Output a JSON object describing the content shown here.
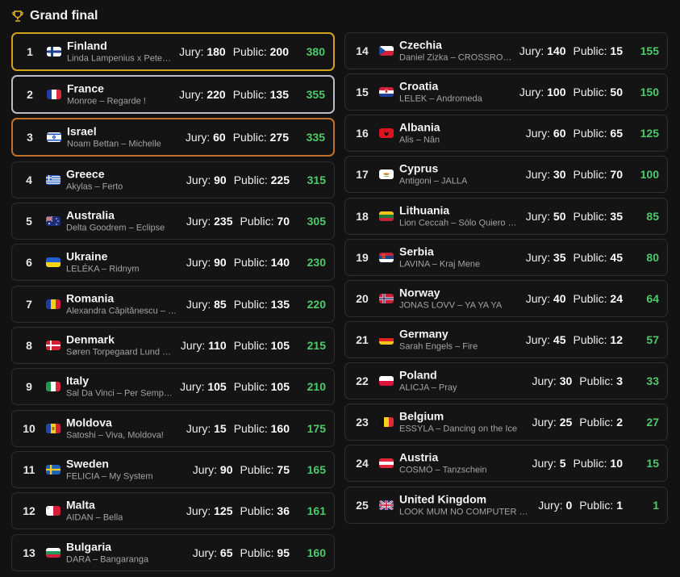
{
  "header": {
    "title": "Grand final",
    "icon": "trophy-icon"
  },
  "labels": {
    "jury": "Jury:",
    "public": "Public:"
  },
  "colors": {
    "gold": "#d4a21a",
    "silver": "#b9bec6",
    "bronze": "#c0702a",
    "total": "#4ccb6a"
  },
  "entries": [
    {
      "rank": "1",
      "country": "Finland",
      "artist": "Linda Lampenius x Pete…",
      "jury": "180",
      "public": "200",
      "total": "380",
      "flag": "finland-flag-icon"
    },
    {
      "rank": "2",
      "country": "France",
      "artist": "Monroe – Regarde !",
      "jury": "220",
      "public": "135",
      "total": "355",
      "flag": "france-flag-icon"
    },
    {
      "rank": "3",
      "country": "Israel",
      "artist": "Noam Bettan – Michelle",
      "jury": "60",
      "public": "275",
      "total": "335",
      "flag": "israel-flag-icon"
    },
    {
      "rank": "4",
      "country": "Greece",
      "artist": "Akylas – Ferto",
      "jury": "90",
      "public": "225",
      "total": "315",
      "flag": "greece-flag-icon"
    },
    {
      "rank": "5",
      "country": "Australia",
      "artist": "Delta Goodrem – Eclipse",
      "jury": "235",
      "public": "70",
      "total": "305",
      "flag": "australia-flag-icon"
    },
    {
      "rank": "6",
      "country": "Ukraine",
      "artist": "LELÉKA – Ridnym",
      "jury": "90",
      "public": "140",
      "total": "230",
      "flag": "ukraine-flag-icon"
    },
    {
      "rank": "7",
      "country": "Romania",
      "artist": "Alexandra Căpitănescu – …",
      "jury": "85",
      "public": "135",
      "total": "220",
      "flag": "romania-flag-icon"
    },
    {
      "rank": "8",
      "country": "Denmark",
      "artist": "Søren Torpegaard Lund …",
      "jury": "110",
      "public": "105",
      "total": "215",
      "flag": "denmark-flag-icon"
    },
    {
      "rank": "9",
      "country": "Italy",
      "artist": "Sal Da Vinci – Per Semp…",
      "jury": "105",
      "public": "105",
      "total": "210",
      "flag": "italy-flag-icon"
    },
    {
      "rank": "10",
      "country": "Moldova",
      "artist": "Satoshi – Viva, Moldova!",
      "jury": "15",
      "public": "160",
      "total": "175",
      "flag": "moldova-flag-icon"
    },
    {
      "rank": "11",
      "country": "Sweden",
      "artist": "FELICIA – My System",
      "jury": "90",
      "public": "75",
      "total": "165",
      "flag": "sweden-flag-icon"
    },
    {
      "rank": "12",
      "country": "Malta",
      "artist": "AIDAN – Bella",
      "jury": "125",
      "public": "36",
      "total": "161",
      "flag": "malta-flag-icon"
    },
    {
      "rank": "13",
      "country": "Bulgaria",
      "artist": "DARA – Bangaranga",
      "jury": "65",
      "public": "95",
      "total": "160",
      "flag": "bulgaria-flag-icon"
    },
    {
      "rank": "14",
      "country": "Czechia",
      "artist": "Daniel Zizka – CROSSRO…",
      "jury": "140",
      "public": "15",
      "total": "155",
      "flag": "czechia-flag-icon"
    },
    {
      "rank": "15",
      "country": "Croatia",
      "artist": "LELEK – Andromeda",
      "jury": "100",
      "public": "50",
      "total": "150",
      "flag": "croatia-flag-icon"
    },
    {
      "rank": "16",
      "country": "Albania",
      "artist": "Alis – Nân",
      "jury": "60",
      "public": "65",
      "total": "125",
      "flag": "albania-flag-icon"
    },
    {
      "rank": "17",
      "country": "Cyprus",
      "artist": "Antigoni – JALLA",
      "jury": "30",
      "public": "70",
      "total": "100",
      "flag": "cyprus-flag-icon"
    },
    {
      "rank": "18",
      "country": "Lithuania",
      "artist": "Lion Ceccah – Sólo Quiero …",
      "jury": "50",
      "public": "35",
      "total": "85",
      "flag": "lithuania-flag-icon"
    },
    {
      "rank": "19",
      "country": "Serbia",
      "artist": "LAVINA – Kraj Mene",
      "jury": "35",
      "public": "45",
      "total": "80",
      "flag": "serbia-flag-icon"
    },
    {
      "rank": "20",
      "country": "Norway",
      "artist": "JONAS LOVV – YA YA YA",
      "jury": "40",
      "public": "24",
      "total": "64",
      "flag": "norway-flag-icon"
    },
    {
      "rank": "21",
      "country": "Germany",
      "artist": "Sarah Engels – Fire",
      "jury": "45",
      "public": "12",
      "total": "57",
      "flag": "germany-flag-icon"
    },
    {
      "rank": "22",
      "country": "Poland",
      "artist": "ALICJA – Pray",
      "jury": "30",
      "public": "3",
      "total": "33",
      "flag": "poland-flag-icon"
    },
    {
      "rank": "23",
      "country": "Belgium",
      "artist": "ESSYLA – Dancing on the Ice",
      "jury": "25",
      "public": "2",
      "total": "27",
      "flag": "belgium-flag-icon"
    },
    {
      "rank": "24",
      "country": "Austria",
      "artist": "COSMÓ – Tanzschein",
      "jury": "5",
      "public": "10",
      "total": "15",
      "flag": "austria-flag-icon"
    },
    {
      "rank": "25",
      "country": "United Kingdom",
      "artist": "LOOK MUM NO COMPUTER …",
      "jury": "0",
      "public": "1",
      "total": "1",
      "flag": "united-kingdom-flag-icon"
    }
  ]
}
